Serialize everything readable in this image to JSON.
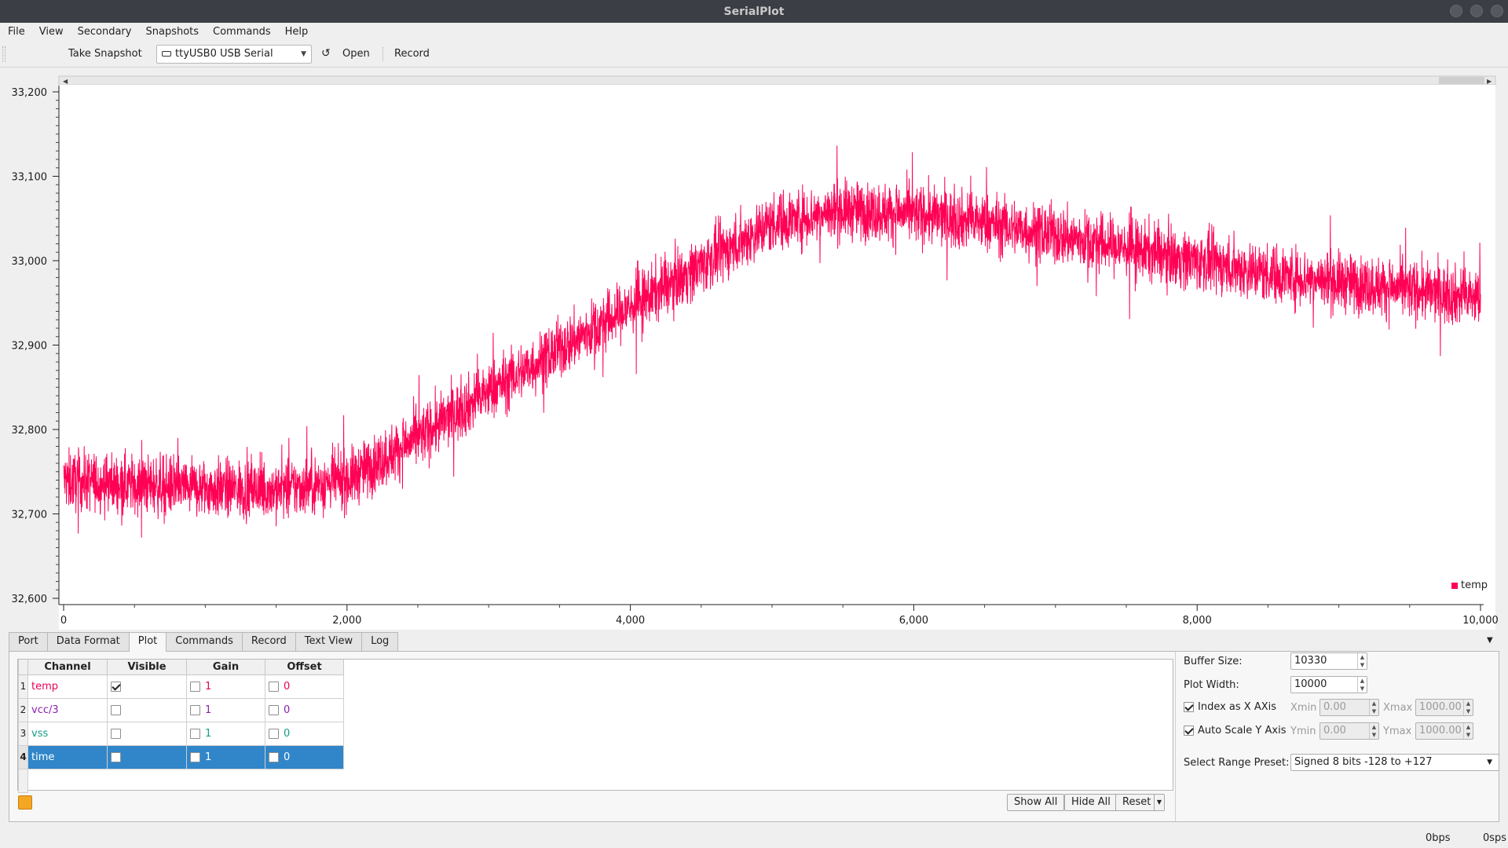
{
  "window": {
    "title": "SerialPlot"
  },
  "menu": [
    "File",
    "View",
    "Secondary",
    "Snapshots",
    "Commands",
    "Help"
  ],
  "toolbar": {
    "take_snapshot": "Take Snapshot",
    "port": "ttyUSB0 USB Serial",
    "refresh_icon": "↺",
    "open": "Open",
    "record": "Record"
  },
  "colors": {
    "series": "#ff0055",
    "selection": "#3086c9",
    "color_button": "#f5a623"
  },
  "chart_data": {
    "type": "line",
    "title": "",
    "xlabel": "",
    "ylabel": "",
    "xlim": [
      0,
      10000
    ],
    "ylim": [
      32600,
      33200
    ],
    "x_ticks": [
      0,
      2000,
      4000,
      6000,
      8000,
      10000
    ],
    "x_tick_labels": [
      "0",
      "2,000",
      "4,000",
      "6,000",
      "8,000",
      "10,000"
    ],
    "y_ticks": [
      32600,
      32700,
      32800,
      32900,
      33000,
      33100,
      33200
    ],
    "y_tick_labels": [
      "32,600",
      "32,700",
      "32,800",
      "32,900",
      "33,000",
      "33,100",
      "33,200"
    ],
    "legend": {
      "position": "bottom-right",
      "entries": [
        "temp"
      ]
    },
    "series": [
      {
        "name": "temp",
        "color": "#ff0055",
        "noise_amplitude": 45,
        "trend_x": [
          0,
          500,
          1000,
          1500,
          2000,
          2500,
          3000,
          3500,
          4000,
          4500,
          5000,
          5500,
          6000,
          6500,
          7000,
          7500,
          8000,
          8500,
          9000,
          9500,
          10000
        ],
        "trend_y": [
          32740,
          32735,
          32730,
          32728,
          32740,
          32790,
          32845,
          32895,
          32945,
          32995,
          33045,
          33060,
          33055,
          33045,
          33030,
          33015,
          33000,
          32985,
          32975,
          32965,
          32955
        ]
      }
    ]
  },
  "tabs": [
    "Port",
    "Data Format",
    "Plot",
    "Commands",
    "Record",
    "Text View",
    "Log"
  ],
  "active_tab": "Plot",
  "channels": {
    "headers": [
      "Channel",
      "Visible",
      "Gain",
      "Offset"
    ],
    "rows": [
      {
        "num": "1",
        "name": "temp",
        "visible": true,
        "gain": "1",
        "offset": "0",
        "color": "#e8005a"
      },
      {
        "num": "2",
        "name": "vcc/3",
        "visible": false,
        "gain": "1",
        "offset": "0",
        "color": "#8b1fb0"
      },
      {
        "num": "3",
        "name": "vss",
        "visible": false,
        "gain": "1",
        "offset": "0",
        "color": "#149e86"
      },
      {
        "num": "4",
        "name": "time",
        "visible": false,
        "gain": "1",
        "offset": "0",
        "color": "#ffffff"
      }
    ]
  },
  "plot_controls": {
    "show_all": "Show All",
    "hide_all": "Hide All",
    "reset": "Reset"
  },
  "settings": {
    "buffer_size_label": "Buffer Size:",
    "buffer_size": "10330",
    "plot_width_label": "Plot Width:",
    "plot_width": "10000",
    "index_as_x_label": "Index as X AXis",
    "index_as_x": true,
    "auto_scale_label": "Auto Scale Y Axis",
    "auto_scale": true,
    "xmin_label": "Xmin",
    "xmin": "0.00",
    "xmax_label": "Xmax",
    "xmax": "1000.00",
    "ymin_label": "Ymin",
    "ymin": "0.00",
    "ymax_label": "Ymax",
    "ymax": "1000.00",
    "range_preset_label": "Select Range Preset:",
    "range_preset": "Signed 8 bits -128 to +127"
  },
  "status": {
    "bps": "0bps",
    "sps": "0sps"
  }
}
